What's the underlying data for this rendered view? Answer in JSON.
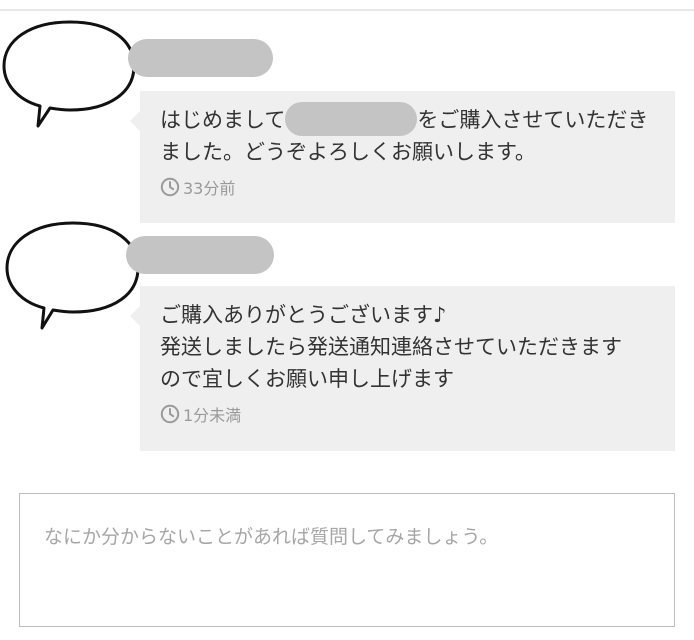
{
  "messages": [
    {
      "line1_before_mask": "はじめまして",
      "line1_after_mask": "をご購入させていただき",
      "line2": "ました。どうぞよろしくお願いします。",
      "time": "33分前",
      "clock_icon": "clock-icon"
    },
    {
      "line1": "ご購入ありがとうございます♪",
      "line2": "発送しましたら発送通知連絡させていただきます",
      "line3": "ので宜しくお願い申し上げます",
      "time": "1分未満",
      "clock_icon": "clock-icon"
    }
  ],
  "question": {
    "placeholder": "なにか分からないことがあれば質問してみましょう。",
    "value": ""
  },
  "colors": {
    "bubble_bg": "#efefef",
    "redaction": "#c4c4c4",
    "meta_text": "#9a9a9a",
    "border": "#bdbdbd"
  }
}
